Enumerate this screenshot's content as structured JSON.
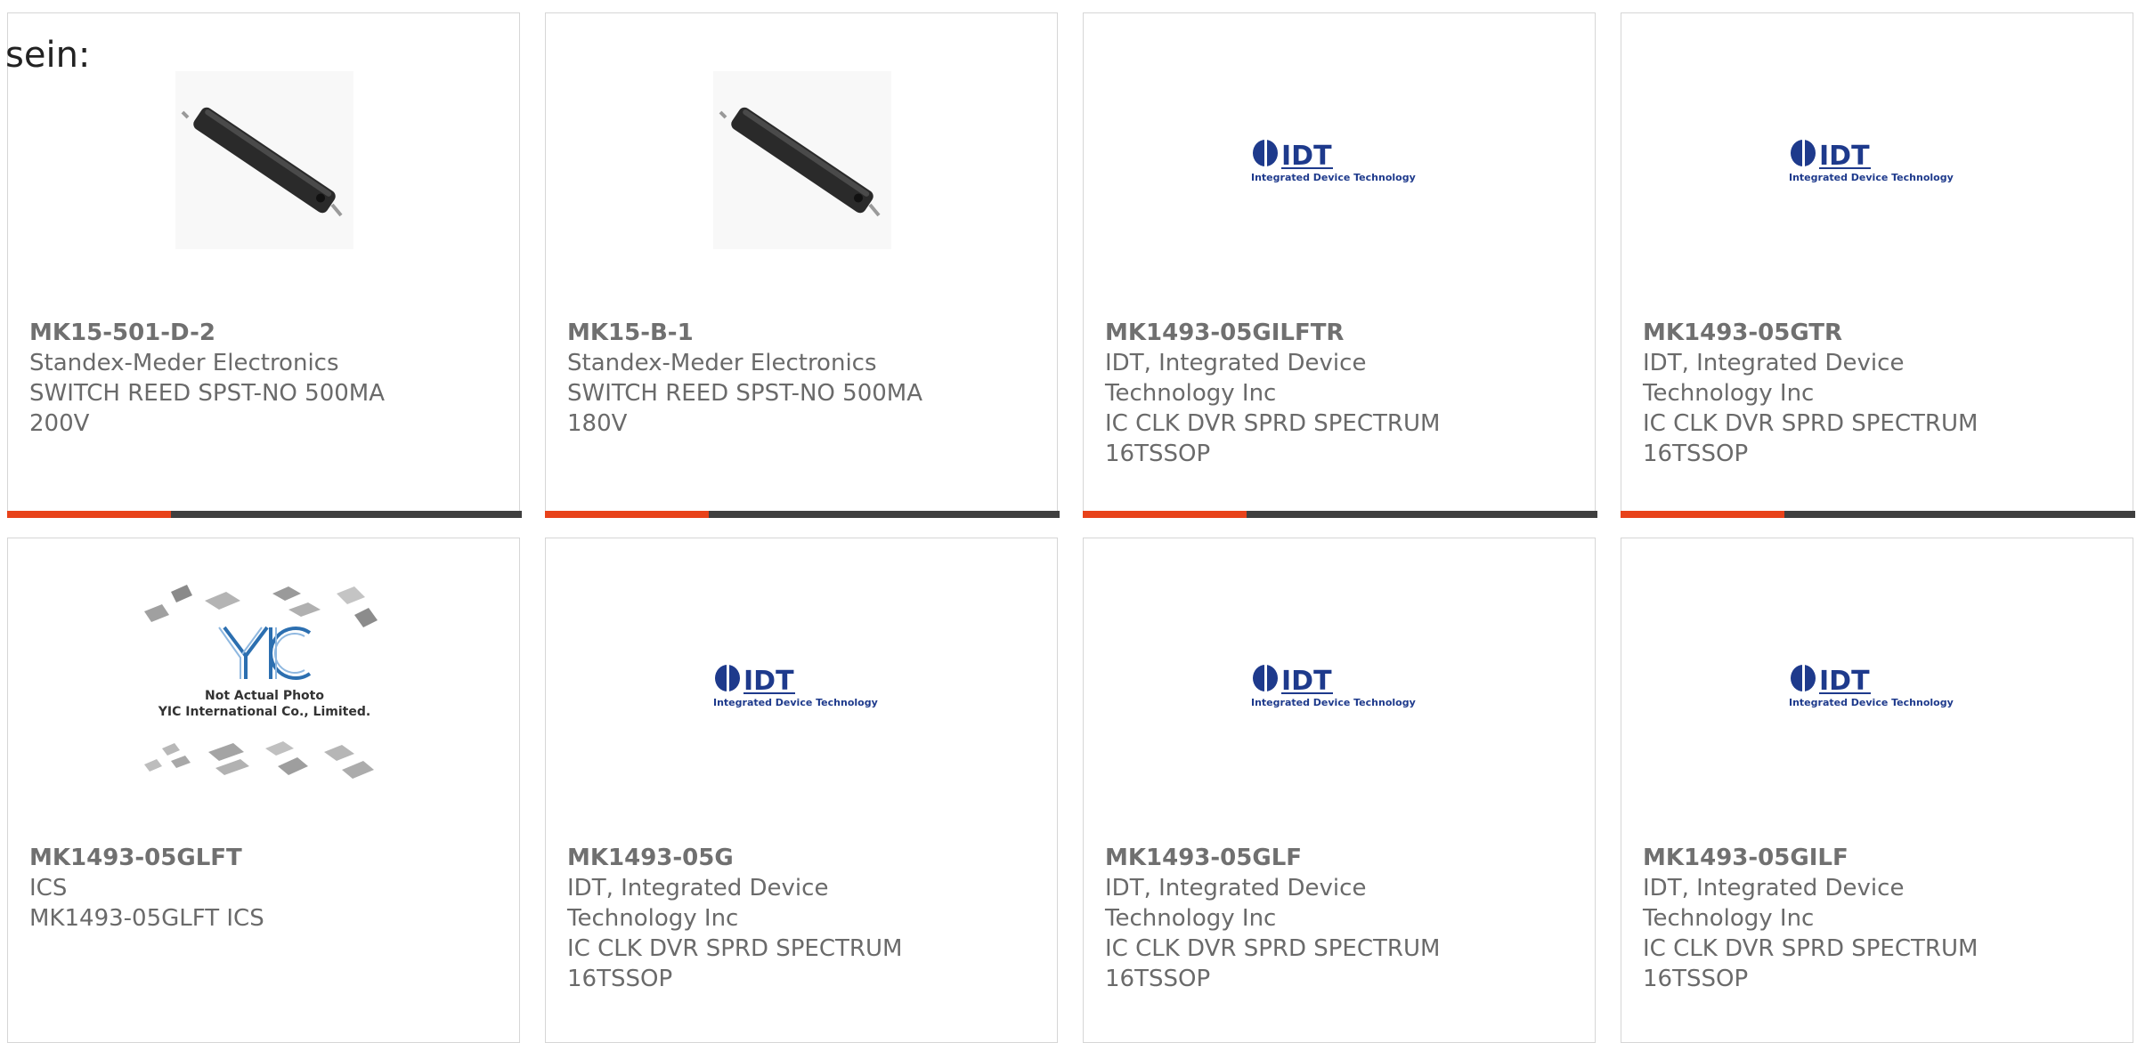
{
  "heading": "sein:",
  "cards": [
    {
      "part_number": "MK15-501-D-2",
      "manufacturer": "Standex-Meder Electronics",
      "description_lines": [
        "SWITCH REED SPST-NO 500MA",
        "200V"
      ],
      "image": "reed-switch",
      "image_text": [],
      "show_bar": true
    },
    {
      "part_number": "MK15-B-1",
      "manufacturer": "Standex-Meder Electronics",
      "description_lines": [
        "SWITCH REED SPST-NO 500MA",
        "180V"
      ],
      "image": "reed-switch",
      "image_text": [],
      "show_bar": true
    },
    {
      "part_number": "MK1493-05GILFTR",
      "manufacturer_lines": [
        "IDT, Integrated Device",
        "Technology Inc"
      ],
      "description_lines": [
        "IC CLK DVR SPRD SPECTRUM",
        "16TSSOP"
      ],
      "image": "idt-logo",
      "image_text": [
        "IDT",
        "Integrated Device Technology"
      ],
      "show_bar": true
    },
    {
      "part_number": "MK1493-05GTR",
      "manufacturer_lines": [
        "IDT, Integrated Device",
        "Technology Inc"
      ],
      "description_lines": [
        "IC CLK DVR SPRD SPECTRUM",
        "16TSSOP"
      ],
      "image": "idt-logo",
      "image_text": [
        "IDT",
        "Integrated Device Technology"
      ],
      "show_bar": true
    },
    {
      "part_number": "MK1493-05GLFT",
      "manufacturer": "ICS",
      "description_lines": [
        "MK1493-05GLFT ICS"
      ],
      "image": "yic-placeholder",
      "image_text": [
        "Not Actual Photo",
        "YIC International Co., Limited."
      ],
      "show_bar": false
    },
    {
      "part_number": "MK1493-05G",
      "manufacturer_lines": [
        "IDT, Integrated Device",
        "Technology Inc"
      ],
      "description_lines": [
        "IC CLK DVR SPRD SPECTRUM",
        "16TSSOP"
      ],
      "image": "idt-logo",
      "image_text": [
        "IDT",
        "Integrated Device Technology"
      ],
      "show_bar": false
    },
    {
      "part_number": "MK1493-05GLF",
      "manufacturer_lines": [
        "IDT, Integrated Device",
        "Technology Inc"
      ],
      "description_lines": [
        "IC CLK DVR SPRD SPECTRUM",
        "16TSSOP"
      ],
      "image": "idt-logo",
      "image_text": [
        "IDT",
        "Integrated Device Technology"
      ],
      "show_bar": false
    },
    {
      "part_number": "MK1493-05GILF",
      "manufacturer_lines": [
        "IDT, Integrated Device",
        "Technology Inc"
      ],
      "description_lines": [
        "IC CLK DVR SPRD SPECTRUM",
        "16TSSOP"
      ],
      "image": "idt-logo",
      "image_text": [
        "IDT",
        "Integrated Device Technology"
      ],
      "show_bar": false
    }
  ],
  "colors": {
    "accent_bar": "#e8421a",
    "dark_bar": "#3f3f3f",
    "idt_blue": "#1e3a8c",
    "text_gray": "#6a6a6a",
    "border": "#d6d6d6"
  }
}
